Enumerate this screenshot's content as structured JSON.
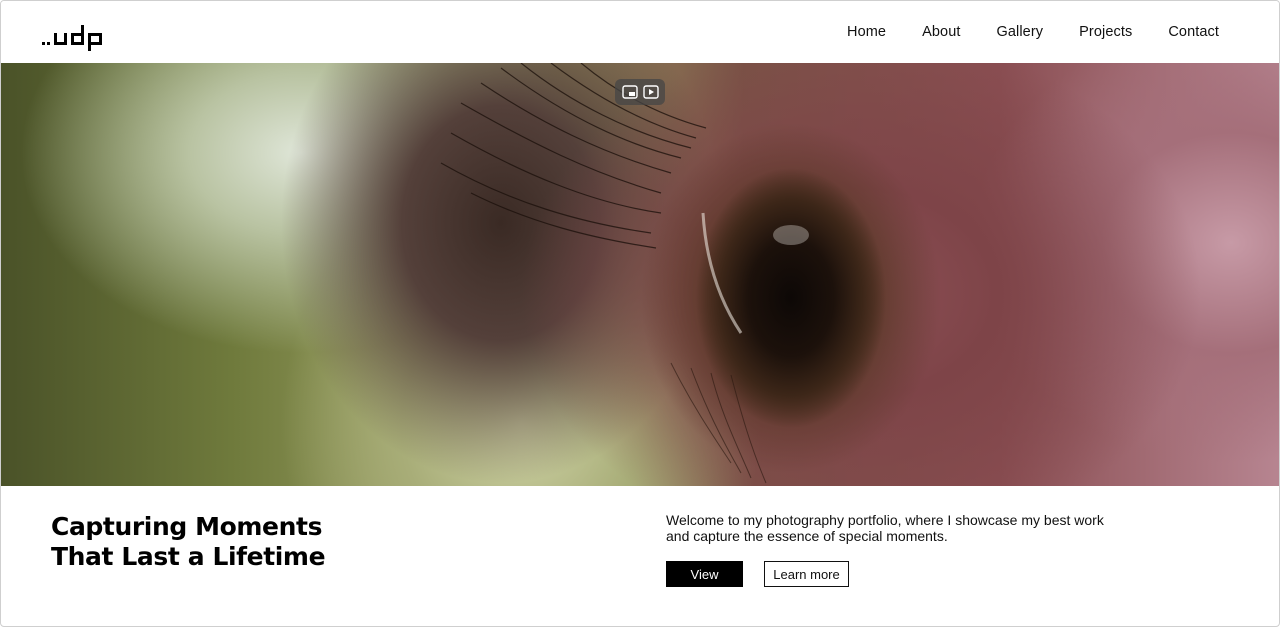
{
  "header": {
    "logo_text": ".udp",
    "nav": [
      {
        "label": "Home"
      },
      {
        "label": "About"
      },
      {
        "label": "Gallery"
      },
      {
        "label": "Projects"
      },
      {
        "label": "Contact"
      }
    ]
  },
  "hero": {
    "image_alt": "close-up of a brown eye",
    "controls": [
      {
        "icon": "picture-in-picture-icon"
      },
      {
        "icon": "video-capture-icon"
      }
    ]
  },
  "intro": {
    "title_line1": "Capturing Moments",
    "title_line2": "That Last a Lifetime",
    "description": "Welcome to my photography portfolio, where I showcase my best work and capture the essence of special moments.",
    "view_label": "View",
    "learn_more_label": "Learn more"
  }
}
